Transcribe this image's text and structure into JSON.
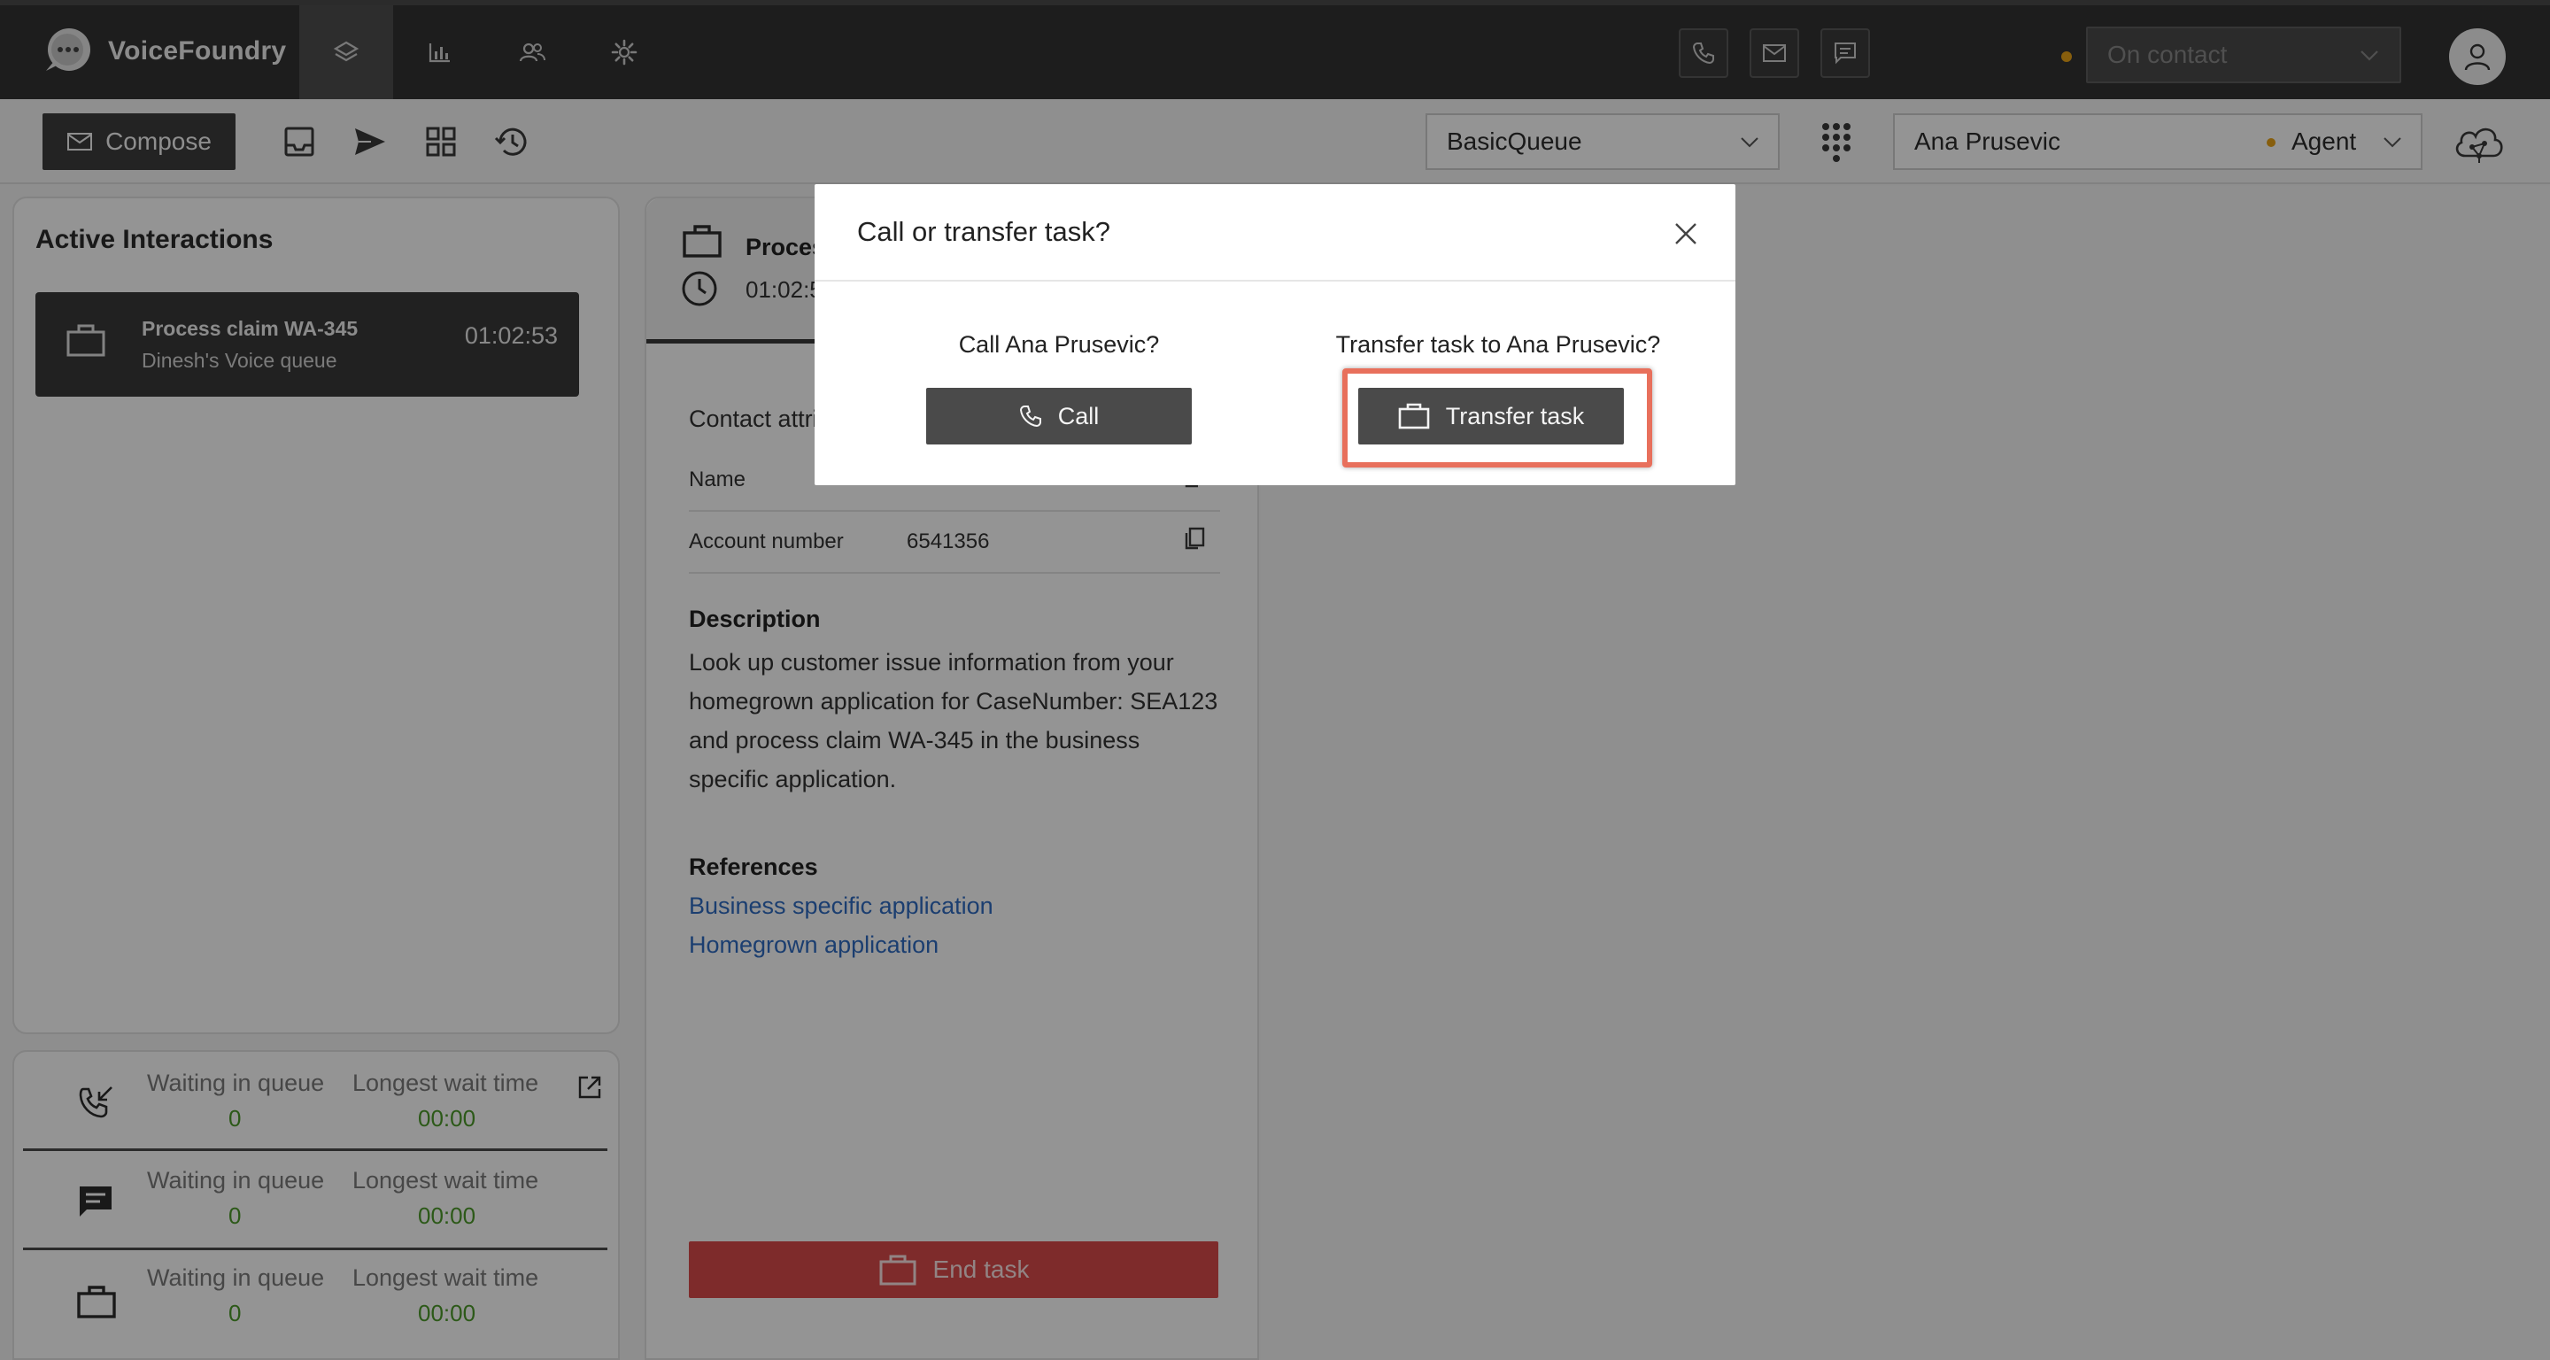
{
  "app": {
    "name": "VoiceFoundry"
  },
  "topbar": {
    "status_value": "On contact",
    "status_dot_color": "#e8a317",
    "nav_icons": [
      "layers-icon",
      "bar-chart-icon",
      "people-icon",
      "settings-icon"
    ],
    "channel_icons": [
      "phone-icon",
      "mail-icon",
      "chat-icon"
    ]
  },
  "toolbar": {
    "compose_label": "Compose",
    "queue_select": "BasicQueue",
    "agent_name": "Ana Prusevic",
    "agent_role": "Agent",
    "agent_dot_color": "#e8a317"
  },
  "left_panel": {
    "title": "Active Interactions",
    "interaction": {
      "title": "Process claim WA-345",
      "queue": "Dinesh's Voice queue",
      "timer": "01:02:53"
    },
    "queue_stats": [
      {
        "icon": "incoming-call-icon",
        "waiting_label": "Waiting in queue",
        "waiting_value": "0",
        "wait_label": "Longest wait time",
        "wait_value": "00:00"
      },
      {
        "icon": "chat-icon",
        "waiting_label": "Waiting in queue",
        "waiting_value": "0",
        "wait_label": "Longest wait time",
        "wait_value": "00:00"
      },
      {
        "icon": "briefcase-icon",
        "waiting_label": "Waiting in queue",
        "waiting_value": "0",
        "wait_label": "Longest wait time",
        "wait_value": "00:00"
      }
    ]
  },
  "center_panel": {
    "tab_title": "Process claim WA-345",
    "tab_timer": "01:02:53",
    "contact_attributes_label": "Contact attributes",
    "attributes": [
      {
        "label": "Name",
        "value": ""
      },
      {
        "label": "Account number",
        "value": "6541356"
      }
    ],
    "description_heading": "Description",
    "description_text": "Look up customer issue information from your homegrown application for CaseNumber: SEA123 and process claim WA-345 in the business specific application.",
    "references_heading": "References",
    "references": [
      "Business specific application",
      "Homegrown application"
    ],
    "end_task_label": "End task"
  },
  "modal": {
    "title": "Call or transfer task?",
    "call_question": "Call Ana Prusevic?",
    "call_label": "Call",
    "transfer_question": "Transfer task to Ana Prusevic?",
    "transfer_label": "Transfer task",
    "highlight_color": "#e8705c"
  }
}
